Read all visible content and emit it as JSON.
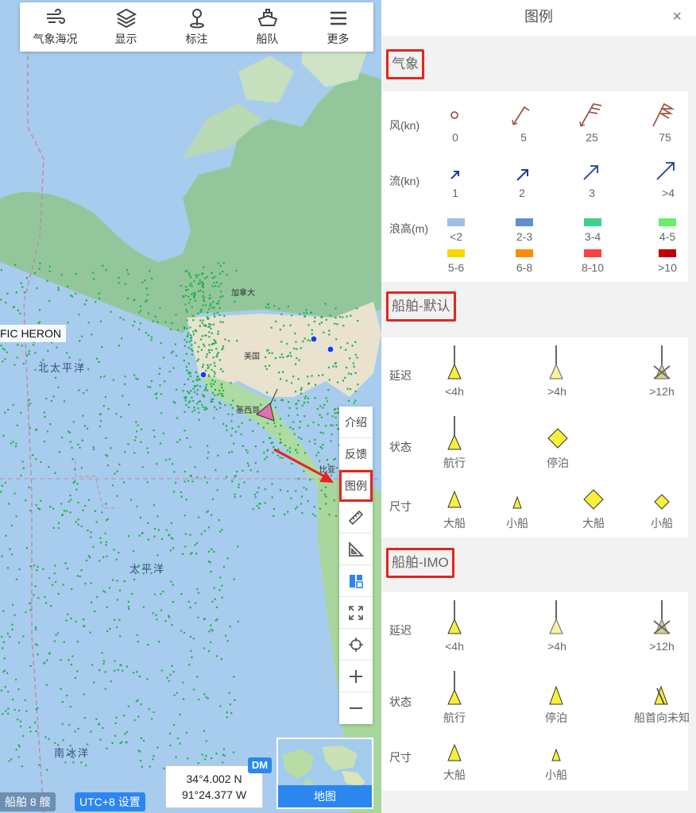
{
  "toolbar": {
    "items": [
      {
        "label": "气象海况",
        "icon": "wind-icon"
      },
      {
        "label": "显示",
        "icon": "layers-icon"
      },
      {
        "label": "标注",
        "icon": "pin-icon"
      },
      {
        "label": "船队",
        "icon": "ship-icon"
      },
      {
        "label": "更多",
        "icon": "menu-icon"
      }
    ]
  },
  "map": {
    "labels": {
      "canada": "加拿大",
      "usa": "美国",
      "mexico": "墨西哥",
      "colombia": "比亚",
      "north_pacific": "北太平洋",
      "pacific": "太平洋",
      "southern_ocean": "南冰洋"
    },
    "ship_name": "FIC HERON",
    "tools": [
      {
        "label": "介绍"
      },
      {
        "label": "反馈"
      },
      {
        "label": "图例"
      }
    ],
    "tool_icons": [
      "ruler-icon",
      "triangle-ruler-icon",
      "layout-icon",
      "fullscreen-icon",
      "locate-icon",
      "plus-icon",
      "minus-icon"
    ],
    "coords": {
      "lat": "34°4.002 N",
      "lon": "91°24.377 W",
      "badge": "DM"
    },
    "thumb_label": "地图",
    "ship_count": "船舶 8 艘",
    "utc": "UTC+8 设置"
  },
  "legend": {
    "title": "图例",
    "close": "×",
    "weather": {
      "title": "气象",
      "wind_label": "风(kn)",
      "wind_values": [
        "0",
        "5",
        "25",
        "75"
      ],
      "current_label": "流(kn)",
      "current_values": [
        "1",
        "2",
        "3",
        ">4"
      ],
      "wave_label": "浪高(m)",
      "wave_values": [
        "<2",
        "2-3",
        "3-4",
        "4-5",
        "5-6",
        "6-8",
        "8-10",
        ">10"
      ],
      "wave_colors": [
        "#9fbfe4",
        "#5f8fcf",
        "#3ccf8e",
        "#66f06a",
        "#f5d800",
        "#ff8c00",
        "#ff4040",
        "#c00000"
      ]
    },
    "default": {
      "title": "船舶-默认",
      "delay_label": "延迟",
      "delay_values": [
        "<4h",
        ">4h",
        ">12h"
      ],
      "status_label": "状态",
      "status_values": [
        "航行",
        "停泊"
      ],
      "size_label": "尺寸",
      "size_values": [
        "大船",
        "小船",
        "大船",
        "小船"
      ]
    },
    "imo": {
      "title": "船舶-IMO",
      "delay_label": "延迟",
      "delay_values": [
        "<4h",
        ">4h",
        ">12h"
      ],
      "status_label": "状态",
      "status_values": [
        "航行",
        "停泊",
        "船首向未知"
      ],
      "size_label": "尺寸",
      "size_values": [
        "大船",
        "小船"
      ]
    }
  }
}
